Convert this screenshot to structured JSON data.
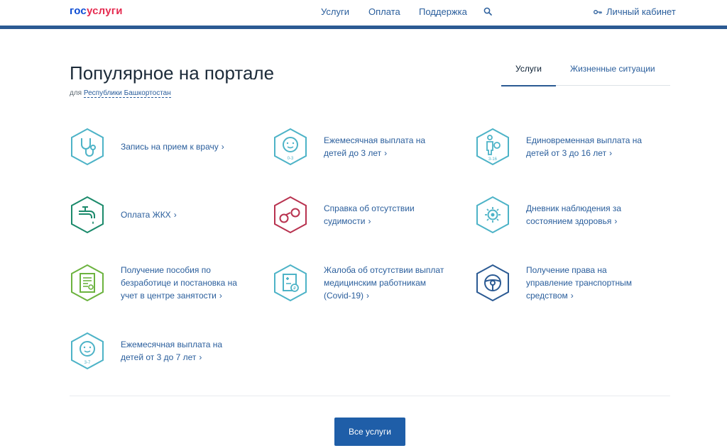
{
  "header": {
    "logo_part1": "гос",
    "logo_part2": "услуги",
    "nav": [
      "Услуги",
      "Оплата",
      "Поддержка"
    ],
    "search_icon": "search-icon",
    "cabinet_label": "Личный кабинет",
    "cabinet_icon": "key-icon",
    "bar_color": "#2b5a93"
  },
  "main": {
    "title": "Популярное на портале",
    "region_prefix": "для",
    "region_link": "Республики Башкортостан"
  },
  "tabs": [
    {
      "label": "Услуги",
      "active": true
    },
    {
      "label": "Жизненные ситуации",
      "active": false
    }
  ],
  "services": [
    {
      "label": "Запись на прием к врачу",
      "icon": "stethoscope-icon",
      "color": "#4db3c7"
    },
    {
      "label": "Ежемесячная выплата на детей до 3 лет",
      "icon": "baby-0-3-icon",
      "color": "#4db3c7",
      "badge": "0-3"
    },
    {
      "label": "Единовременная выплата на детей от 3 до 16 лет",
      "icon": "child-3-16-icon",
      "color": "#4db3c7",
      "badge": "3-16"
    },
    {
      "label": "Оплата ЖКХ",
      "icon": "faucet-icon",
      "color": "#1b8a6b"
    },
    {
      "label": "Справка об отсутствии судимости",
      "icon": "handcuffs-icon",
      "color": "#b8324f"
    },
    {
      "label": "Дневник наблюдения за состоянием здоровья",
      "icon": "virus-icon",
      "color": "#4db3c7"
    },
    {
      "label": "Получение пособия по безработице и постановка на учет в центре занятости",
      "icon": "document-icon",
      "color": "#6cb33f"
    },
    {
      "label": "Жалоба об отсутствии выплат медицинским работникам (Covid-19)",
      "icon": "medical-card-icon",
      "color": "#4db3c7"
    },
    {
      "label": "Получение права на управление транспортным средством",
      "icon": "steering-wheel-icon",
      "color": "#2b5a93"
    },
    {
      "label": "Ежемесячная выплата на детей от 3 до 7 лет",
      "icon": "baby-3-7-icon",
      "color": "#4db3c7",
      "badge": "3-7"
    }
  ],
  "all_services_button": "Все услуги"
}
